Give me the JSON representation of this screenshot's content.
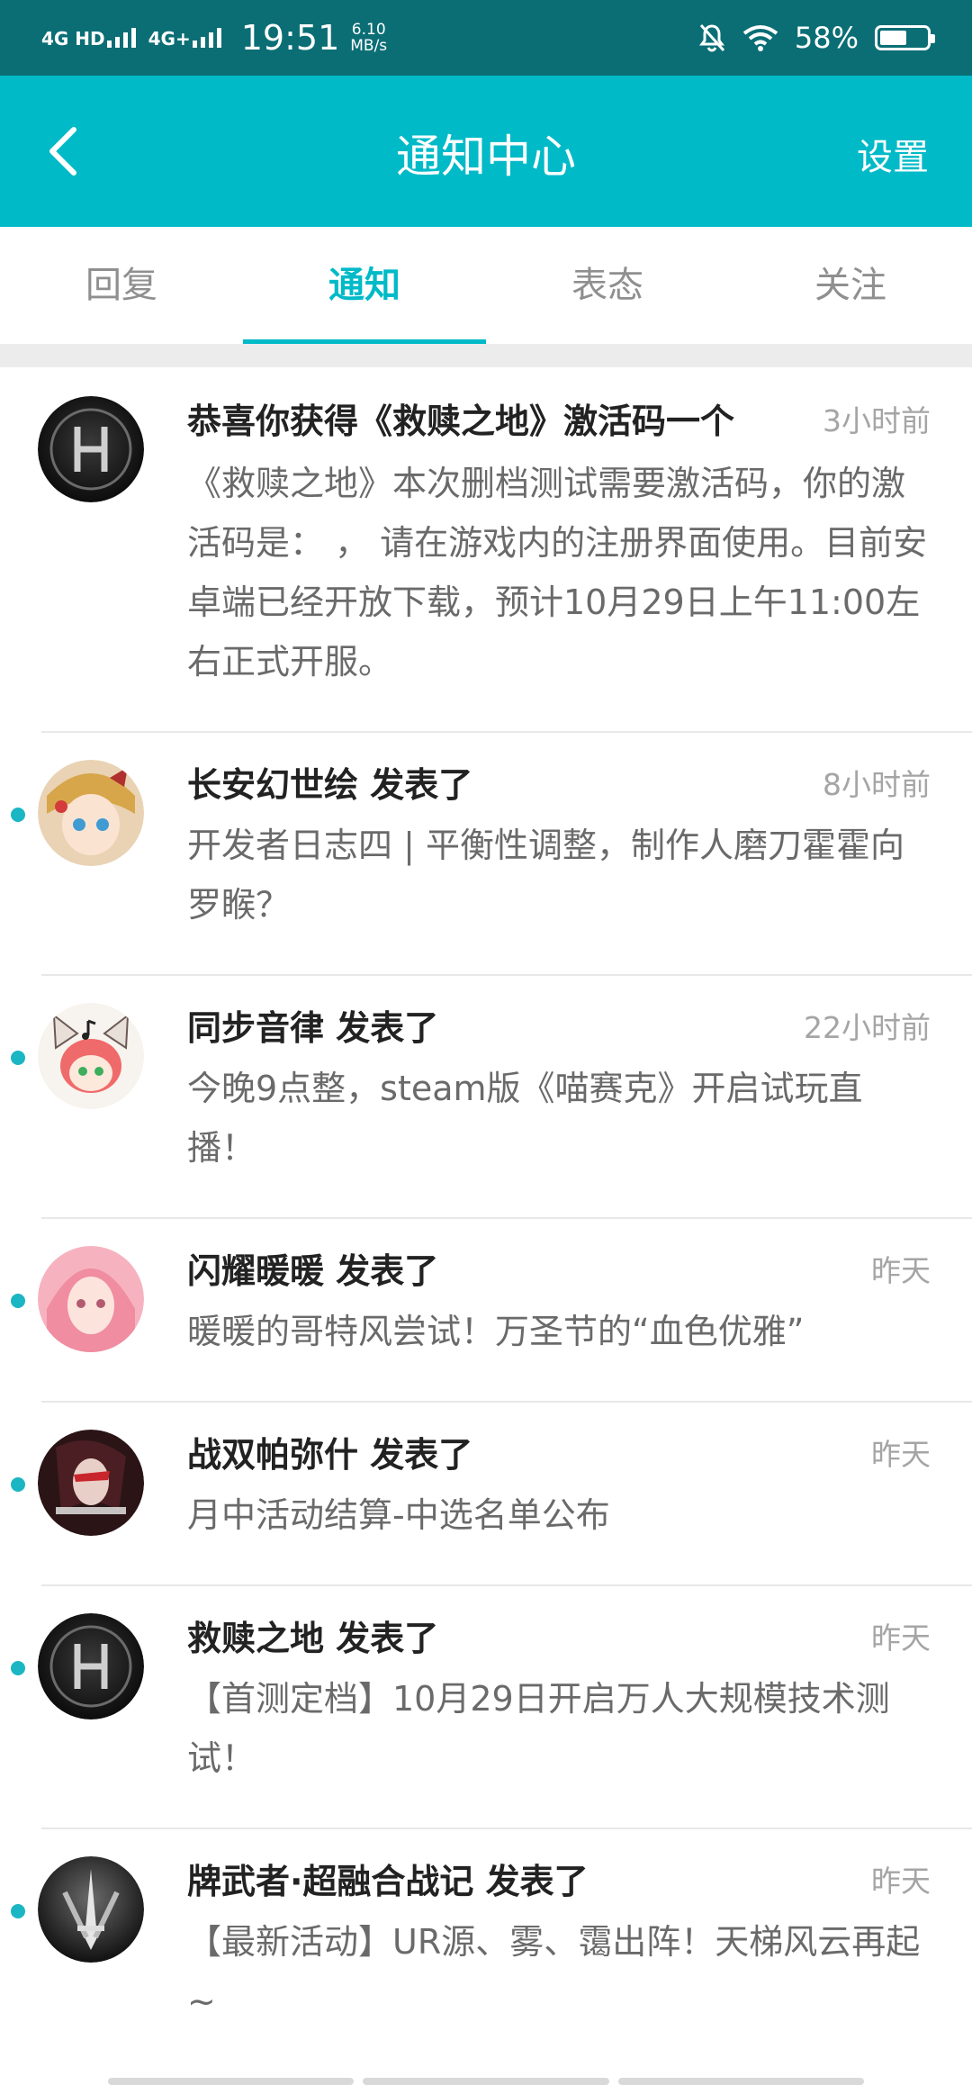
{
  "status_bar": {
    "network_1": "4G HD",
    "network_2": "4G+",
    "time": "19:51",
    "speed_value": "6.10",
    "speed_unit": "MB/s",
    "battery": "58%",
    "battery_level": 0.58,
    "icons": [
      "signal-icon",
      "signal-icon",
      "bell-off-icon",
      "wifi-icon",
      "battery-icon"
    ]
  },
  "header": {
    "back_icon": "chevron-left-icon",
    "title": "通知中心",
    "settings_label": "设置"
  },
  "tabs": [
    {
      "label": "回复",
      "active": false
    },
    {
      "label": "通知",
      "active": true
    },
    {
      "label": "表态",
      "active": false
    },
    {
      "label": "关注",
      "active": false
    }
  ],
  "colors": {
    "status_bar": "#0b6e75",
    "accent": "#00bac8",
    "unread_dot": "#1ab6c4"
  },
  "notifications": [
    {
      "title": "恭喜你获得《救赎之地》激活码一个",
      "time": "3小时前",
      "body": "《救赎之地》本次删档测试需要激活码，你的激活码是：          ，  请在游戏内的注册界面使用。目前安卓端已经开放下载，预计10月29日上午11:00左右正式开服。",
      "avatar": "H-logo-avatar",
      "unread": false
    },
    {
      "title": "长安幻世绘 发表了",
      "time": "8小时前",
      "body": "开发者日志四 | 平衡性调整，制作人磨刀霍霍向罗睺？",
      "avatar": "anime-girl-avatar",
      "unread": true
    },
    {
      "title": "同步音律 发表了",
      "time": "22小时前",
      "body": "今晚9点整，steam版《喵赛克》开启试玩直播！",
      "avatar": "cat-girl-avatar",
      "unread": true
    },
    {
      "title": "闪耀暖暖 发表了",
      "time": "昨天",
      "body": "暖暖的哥特风尝试！万圣节的“血色优雅”",
      "avatar": "pink-hair-avatar",
      "unread": true
    },
    {
      "title": "战双帕弥什 发表了",
      "time": "昨天",
      "body": "月中活动结算-中选名单公布",
      "avatar": "punishing-avatar",
      "unread": true
    },
    {
      "title": "救赎之地 发表了",
      "time": "昨天",
      "body": "【首测定档】10月29日开启万人大规模技术测试！",
      "avatar": "H-logo-avatar",
      "unread": true
    },
    {
      "title": "牌武者·超融合战记 发表了",
      "time": "昨天",
      "body": "【最新活动】UR源、雾、霭出阵！天梯风云再起~",
      "avatar": "blade-emblem-avatar",
      "unread": true
    }
  ]
}
